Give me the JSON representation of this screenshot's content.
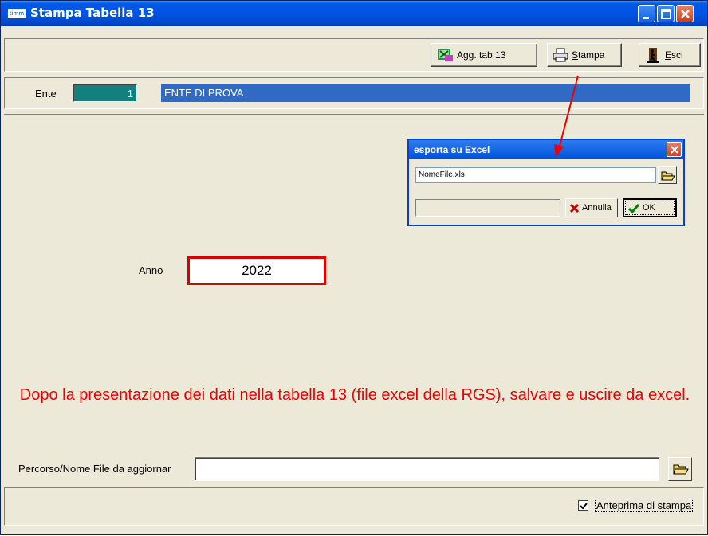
{
  "window": {
    "title": "Stampa Tabella 13",
    "app_icon_text": "timm",
    "controls": [
      "minimize-icon",
      "maximize-icon",
      "close-icon"
    ]
  },
  "toolbar": {
    "agg_label": "Agg. tab.13",
    "stampa_label": "Stampa",
    "esci_label": "Esci"
  },
  "ente": {
    "label": "Ente",
    "code": "1",
    "name": "ENTE DI PROVA"
  },
  "anno": {
    "label": "Anno",
    "value": "2022"
  },
  "message": "Dopo la presentazione dei dati nella tabella 13 (file excel della RGS), salvare e uscire da excel.",
  "path": {
    "label": "Percorso/Nome File da aggiornar",
    "value": ""
  },
  "preview": {
    "label": "Anteprima di stampa",
    "checked": true
  },
  "dialog": {
    "title": "esporta su Excel",
    "filename": "NomeFile.xls",
    "cancel_label": "Annulla",
    "ok_label": "OK"
  },
  "colors": {
    "titlebar": "#0054E3",
    "ente_code_bg": "#138080",
    "ente_name_bg": "#316AC5",
    "highlight_red": "#E00000",
    "message_red": "#F00000"
  }
}
